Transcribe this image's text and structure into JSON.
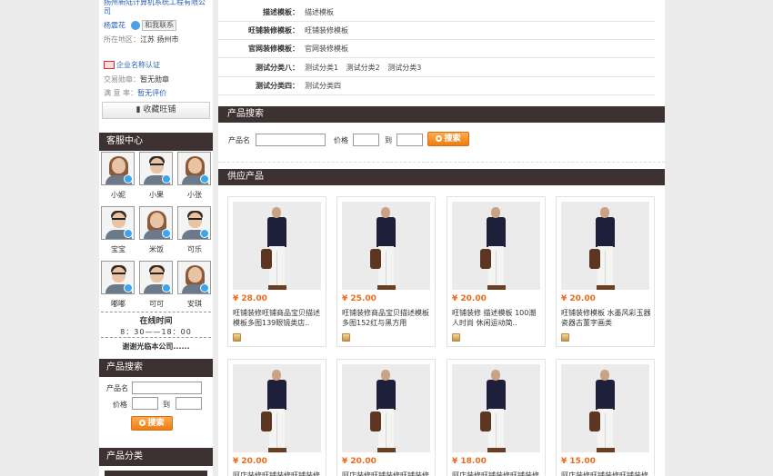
{
  "company": {
    "name": "扬州新陆计算机系统工程有限公司",
    "contact_name": "杨震花",
    "contact_btn": "和我联系",
    "region_label": "所在地区：",
    "region_value": "江苏 扬州市",
    "cert_label": "企业名称认证",
    "trade_label": "交易勋章：",
    "trade_value": "暂无勋章",
    "rating_label": "满 意 率：",
    "rating_value": "暂无评价",
    "fav_btn": "收藏旺铺"
  },
  "customer_service": {
    "title": "客服中心",
    "agents": [
      {
        "name": "小妮",
        "gender": "f"
      },
      {
        "name": "小果",
        "gender": "m"
      },
      {
        "name": "小张",
        "gender": "f"
      },
      {
        "name": "宝宝",
        "gender": "m"
      },
      {
        "name": "米饭",
        "gender": "f"
      },
      {
        "name": "可乐",
        "gender": "m"
      },
      {
        "name": "嘟嘟",
        "gender": "m"
      },
      {
        "name": "可可",
        "gender": "m"
      },
      {
        "name": "安琪",
        "gender": "f"
      }
    ],
    "online_title": "在线时间",
    "online_time": "8：30——18：00",
    "thanks": "谢谢光临本公司......"
  },
  "left_search": {
    "title": "产品搜索",
    "name_label": "产品名",
    "price_label": "价格",
    "to_label": "到",
    "btn": "搜索"
  },
  "left_category": {
    "title": "产品分类"
  },
  "attrs": [
    {
      "key": "描述模板：",
      "value": "描述模板"
    },
    {
      "key": "旺铺装修模板：",
      "value": "旺铺装修模板"
    },
    {
      "key": "官网装修模板：",
      "value": "官网装修模板"
    },
    {
      "key": "测试分类八：",
      "value": "测试分类1 测试分类2 测试分类3"
    },
    {
      "key": "测试分类四：",
      "value": "测试分类四"
    }
  ],
  "right_search": {
    "title": "产品搜索",
    "name_label": "产品名",
    "price_label": "价格",
    "to_label": "到",
    "btn": "搜索"
  },
  "supply": {
    "title": "供应产品",
    "products": [
      {
        "price": "¥ 28.00",
        "desc": "旺铺装修旺铺商品宝贝描述模板多图139眼镜类店.."
      },
      {
        "price": "¥ 25.00",
        "desc": "旺铺装修商品宝贝描述模板多图152红与黑方用"
      },
      {
        "price": "¥ 20.00",
        "desc": "旺铺装修 描述模板 100潮人时尚 休闲运动简.."
      },
      {
        "price": "¥ 20.00",
        "desc": "旺铺装修模板 水墨风彩玉器瓷器古董字画类"
      },
      {
        "price": "¥ 20.00",
        "desc": "阿店装修旺铺装修旺铺装修"
      },
      {
        "price": "¥ 20.00",
        "desc": "阿店装修旺铺装修旺铺装修"
      },
      {
        "price": "¥ 18.00",
        "desc": "阿店装修旺铺装修旺铺装修"
      },
      {
        "price": "¥ 15.00",
        "desc": "阿店装修旺铺装修旺铺装修"
      }
    ]
  }
}
